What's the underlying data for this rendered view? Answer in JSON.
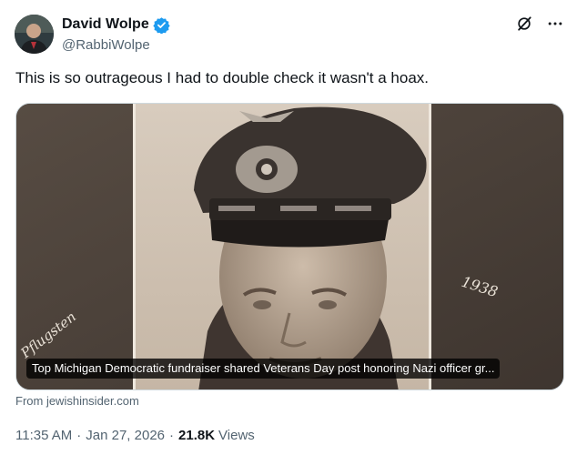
{
  "author": {
    "display_name": "David Wolpe",
    "handle": "@RabbiWolpe",
    "verified": true
  },
  "icons": [
    "grok-icon",
    "more-icon",
    "verified-badge-icon"
  ],
  "tweet": {
    "text": "This is so outrageous I had to double check it wasn't a hoax."
  },
  "media": {
    "caption": "Top Michigan Democratic fundraiser shared Veterans Day post honoring Nazi officer gr...",
    "handwritten_year": "1938"
  },
  "link": {
    "source": "From jewishinsider.com"
  },
  "meta": {
    "time": "11:35 AM",
    "separator": "·",
    "date": "Jan 27, 2026",
    "views_count": "21.8K",
    "views_label": "Views"
  },
  "colors": {
    "text_primary": "#0f1419",
    "text_secondary": "#536471",
    "verified_blue": "#1d9bf0"
  }
}
